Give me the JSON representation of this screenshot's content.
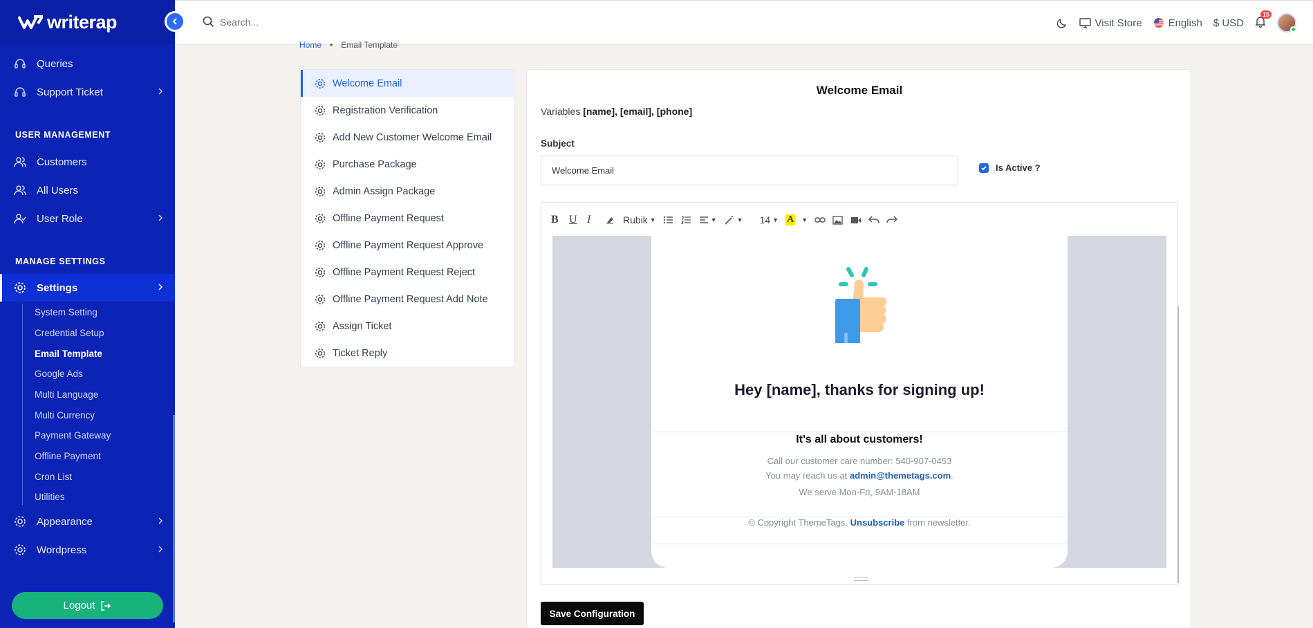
{
  "brand": {
    "name": "writerap"
  },
  "sidebar": {
    "items": [
      {
        "label": "Queries"
      },
      {
        "label": "Support Ticket"
      },
      {
        "label": "Customers"
      },
      {
        "label": "All Users"
      },
      {
        "label": "User Role"
      },
      {
        "label": "Settings"
      },
      {
        "label": "Appearance"
      },
      {
        "label": "Wordpress"
      }
    ],
    "sections": {
      "user_management": "USER MANAGEMENT",
      "manage_settings": "MANAGE SETTINGS"
    },
    "settings_sub": [
      "System Setting",
      "Credential Setup",
      "Email Template",
      "Google Ads",
      "Multi Language",
      "Multi Currency",
      "Payment Gateway",
      "Offline Payment",
      "Cron List",
      "Utilities"
    ],
    "logout": "Logout"
  },
  "topbar": {
    "search_placeholder": "Search...",
    "visit_store": "Visit Store",
    "language": "English",
    "currency": "$ USD",
    "notifications": "15"
  },
  "breadcrumb": {
    "home": "Home",
    "current": "Email Template"
  },
  "templates": [
    "Welcome Email",
    "Registration Verification",
    "Add New Customer Welcome Email",
    "Purchase Package",
    "Admin Assign Package",
    "Offline Payment Request",
    "Offline Payment Request Approve",
    "Offline Payment Request Reject",
    "Offline Payment Request Add Note",
    "Assign Ticket",
    "Ticket Reply"
  ],
  "editor": {
    "title": "Welcome Email",
    "variables_label": "Variables",
    "variables": "[name], [email], [phone]",
    "subject_label": "Subject",
    "subject_value": "Welcome Email",
    "is_active_label": "Is Active ?",
    "toolbar": {
      "font": "Rubik",
      "size": "14"
    },
    "save_label": "Save Configuration"
  },
  "email": {
    "heading": "Hey [name], thanks for signing up!",
    "subheading": "It's all about customers!",
    "care_line": "Call our customer care number: 540-907-0453",
    "reach_prefix": "You may reach us at ",
    "reach_email": "admin@themetags.com",
    "hours": "We serve Mon-Fri, 9AM-18AM",
    "copyright_prefix": "© Copyright ThemeTags. ",
    "unsubscribe": "Unsubscribe",
    "copyright_suffix": " from newsletter."
  },
  "colors": {
    "sidebar": "#0b24b5",
    "accent": "#2563eb",
    "logout": "#18b27d"
  }
}
